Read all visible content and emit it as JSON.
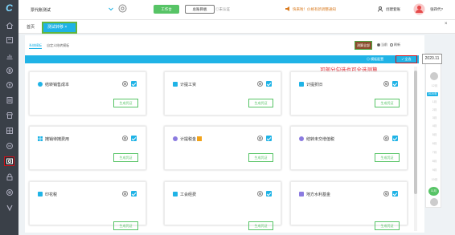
{
  "colors": {
    "accent": "#1fb3e6",
    "green": "#57c466",
    "danger": "#d0101a",
    "sidebar": "#3a4048"
  },
  "sidebar": {
    "logo": "C",
    "items": [
      {
        "icon": "home-icon"
      },
      {
        "icon": "doc-icon"
      },
      {
        "icon": "chart-icon"
      },
      {
        "icon": "coin-icon"
      },
      {
        "icon": "invoice-icon"
      },
      {
        "icon": "receipt-icon"
      },
      {
        "icon": "store-icon"
      },
      {
        "icon": "grid-icon"
      },
      {
        "icon": "cash-icon"
      },
      {
        "icon": "voucher-icon"
      },
      {
        "icon": "lock-icon"
      },
      {
        "icon": "settings-icon"
      },
      {
        "icon": "v-icon"
      }
    ]
  },
  "topbar": {
    "company": "票代账测试",
    "btn_work": "工作台",
    "btn_accounts": "总账目板",
    "auth_status": "◎未认证",
    "notice": "快来啦！价格有新调整通知",
    "create_package": "创建套账",
    "username": "张四代?"
  },
  "tabs": {
    "home": "首页",
    "active": "测试转移 ×"
  },
  "panel": {
    "tab_system": "系统模板",
    "tab_custom": "自定义结转模板",
    "btn_gen_all": "测算全部",
    "radio_current": "当前",
    "radio_refresh": "刷新",
    "tpl_setting": "◎ 模板配置",
    "btn_select_all": "✓ 全选",
    "hint": "可部分勾选也可全选测算"
  },
  "cards": [
    {
      "title": "结转销售成本",
      "icon_color": "#1fb3e6",
      "icon": "money-icon",
      "button": "生成凭证",
      "badge": false
    },
    {
      "title": "计提工资",
      "icon_color": "#1fb3e6",
      "icon": "wage-icon",
      "button": "生成凭证",
      "badge": false
    },
    {
      "title": "计提折旧",
      "icon_color": "#1fb3e6",
      "icon": "depreciation-icon",
      "button": "生成凭证",
      "badge": false
    },
    {
      "title": "摊销待摊费用",
      "icon_color": "#1fb3e6",
      "icon": "amortize-icon",
      "button": "生成凭证",
      "badge": false
    },
    {
      "title": "计提税金",
      "icon_color": "#1fb3e6",
      "icon": "tax-icon",
      "button": "生成凭证",
      "badge": true
    },
    {
      "title": "结转未交增值税",
      "icon_color": "#8b7be0",
      "icon": "vat-icon",
      "button": "生成凭证",
      "badge": false
    },
    {
      "title": "印花税",
      "icon_color": "#1fb3e6",
      "icon": "stamp-icon",
      "button": "生成凭证",
      "badge": false
    },
    {
      "title": "工会经费",
      "icon_color": "#1fb3e6",
      "icon": "union-icon",
      "button": "生成凭证",
      "badge": false
    },
    {
      "title": "地方水利基金",
      "icon_color": "#8b7be0",
      "icon": "fund-icon",
      "button": "生成凭证",
      "badge": false
    }
  ],
  "dates": {
    "year": "2020.11",
    "months": [
      "12月",
      "1月",
      "2月",
      "3月",
      "4月",
      "5月",
      "6月",
      "7月",
      "8月",
      "9月",
      "10月",
      "11月"
    ],
    "selected_month": "2020年",
    "current": "11月"
  }
}
